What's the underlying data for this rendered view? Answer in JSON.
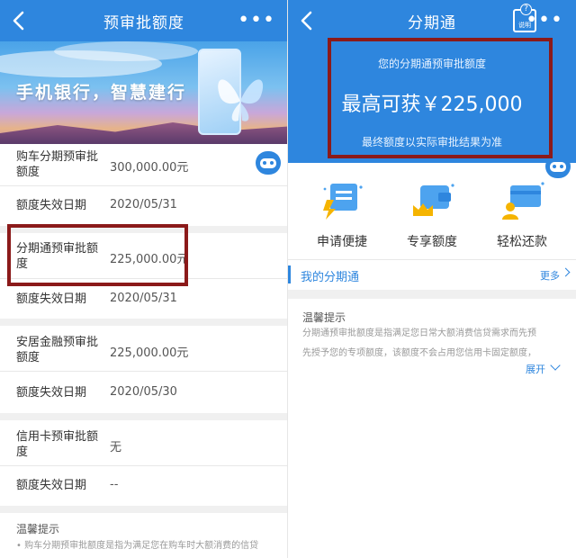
{
  "left": {
    "nav": {
      "title": "预审批额度"
    },
    "banner": {
      "slogan": "手机银行，智慧建行"
    },
    "rows": [
      {
        "label": "购车分期预审批额度",
        "value": "300,000.00元"
      },
      {
        "label": "额度失效日期",
        "value": "2020/05/31"
      },
      {
        "label": "分期通预审批额度",
        "value": "225,000.00元"
      },
      {
        "label": "额度失效日期",
        "value": "2020/05/31"
      },
      {
        "label": "安居金融预审批额度",
        "value": "225,000.00元"
      },
      {
        "label": "额度失效日期",
        "value": "2020/05/30"
      },
      {
        "label": "信用卡预审批额度",
        "value": "无"
      },
      {
        "label": "额度失效日期",
        "value": "--"
      }
    ],
    "tips": {
      "title": "温馨提示",
      "body": "• 购车分期预审批额度是指为满足您在购车时大额消费的信贷"
    }
  },
  "right": {
    "nav": {
      "title": "分期通",
      "help_label": "说明",
      "help_mark": "?"
    },
    "hero": {
      "line1": "您的分期通预审批额度",
      "line2": "最高可获￥225,000",
      "line3": "最终额度以实际审批结果为准"
    },
    "features": [
      {
        "label": "申请便捷",
        "icon": "receipt-lightning-icon"
      },
      {
        "label": "专享额度",
        "icon": "wallet-crown-icon"
      },
      {
        "label": "轻松还款",
        "icon": "card-person-icon"
      }
    ],
    "my": {
      "title": "我的分期通",
      "more": "更多"
    },
    "tips": {
      "title": "温馨提示",
      "line1": "分期通预审批额度是指满足您日常大额消费信贷需求而先预",
      "line2": "先授予您的专项额度，该额度不会占用您信用卡固定额度，",
      "expand": "展开"
    }
  },
  "colors": {
    "brand_blue": "#2e86de",
    "highlight_red": "#8b1a1a"
  }
}
